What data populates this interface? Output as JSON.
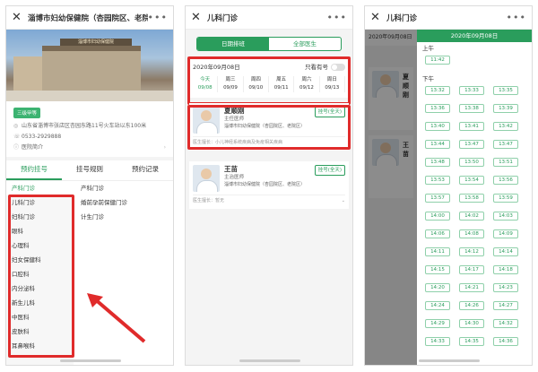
{
  "phone1": {
    "title": "淄博市妇幼保健院（杏园院区、老院区）",
    "hero_sign": "淄博市妇幼保健院",
    "badge": "三级甲等",
    "address": "山东省淄博市张店区杏园东路11号火车站以东100米",
    "phone": "0533-2929888",
    "intro": "医院简介",
    "tabs": [
      "预约挂号",
      "挂号规则",
      "预约记录"
    ],
    "departments": [
      "产科门诊",
      "儿科门诊",
      "妇科门诊",
      "眼科",
      "心理科",
      "妇女保健科",
      "口腔科",
      "内分泌科",
      "新生儿科",
      "中医科",
      "皮肤科",
      "耳鼻喉科"
    ],
    "sub_departments": [
      "产科门诊",
      "婚前孕前保健门诊",
      "计生门诊"
    ]
  },
  "phone2": {
    "title": "儿科门诊",
    "seg": [
      "日期排班",
      "全部医生"
    ],
    "date": "2020年09月08日",
    "only_avail": "只看有号",
    "days": [
      {
        "w": "今天",
        "d": "09/08"
      },
      {
        "w": "周三",
        "d": "09/09"
      },
      {
        "w": "周四",
        "d": "09/10"
      },
      {
        "w": "周五",
        "d": "09/11"
      },
      {
        "w": "周六",
        "d": "09/12"
      },
      {
        "w": "周日",
        "d": "09/13"
      }
    ],
    "doctors": [
      {
        "name": "夏顺刚",
        "title": "主任医师",
        "hospital": "淄博市妇幼保健院（杏园院区、老院区）",
        "btn": "挂号(全天)",
        "specialty": "医生擅长：小儿神经系统疾病及免疫相关疾病"
      },
      {
        "name": "王苗",
        "title": "主治医师",
        "hospital": "淄博市妇幼保健院（杏园院区、老院区）",
        "btn": "挂号(全天)",
        "specialty": "医生擅长：暂无"
      }
    ]
  },
  "phone3": {
    "title": "儿科门诊",
    "popup_date": "2020年09月08日",
    "bg_date": "2020年09月08日",
    "bg_names": [
      "夏顺刚",
      "王苗"
    ],
    "morning": "上午",
    "afternoon": "下午",
    "morning_slots": [
      "11:42"
    ],
    "afternoon_slots": [
      "13:32",
      "13:33",
      "13:35",
      "13:36",
      "13:38",
      "13:39",
      "13:40",
      "13:41",
      "13:42",
      "13:44",
      "13:47",
      "13:47",
      "13:48",
      "13:50",
      "13:51",
      "13:53",
      "13:54",
      "13:56",
      "13:57",
      "13:58",
      "13:59",
      "14:00",
      "14:02",
      "14:03",
      "14:06",
      "14:08",
      "14:09",
      "14:11",
      "14:12",
      "14:14",
      "14:15",
      "14:17",
      "14:18",
      "14:20",
      "14:21",
      "14:23",
      "14:24",
      "14:26",
      "14:27",
      "14:29",
      "14:30",
      "14:32",
      "14:33",
      "14:35",
      "14:36"
    ]
  }
}
